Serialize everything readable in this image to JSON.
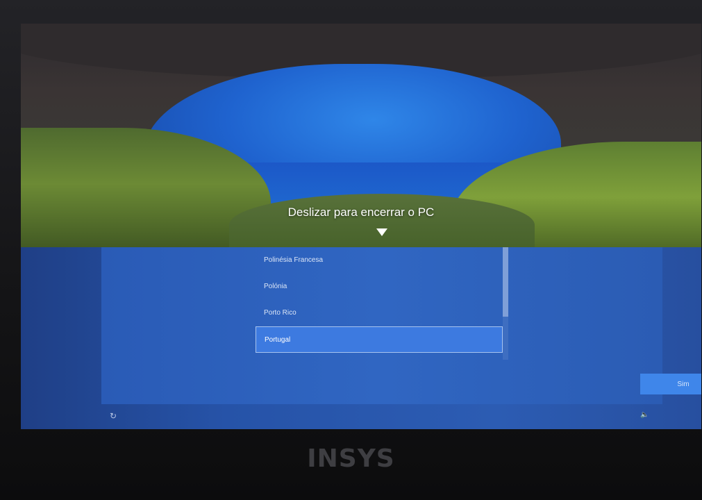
{
  "shutdown": {
    "prompt": "Deslizar para encerrar o PC",
    "arrow_icon": "arrow-down-icon"
  },
  "region_list": {
    "items": [
      "Polinésia Francesa",
      "Polónia",
      "Porto Rico",
      "Portugal"
    ],
    "selected": "Portugal"
  },
  "buttons": {
    "next_label": "Sim"
  },
  "footer": {
    "ease_of_access_icon": "ease-of-access-icon",
    "volume_icon": "volume-icon"
  },
  "device": {
    "brand": "INSYS"
  },
  "colors": {
    "panel": "#2c5cb3",
    "selection": "#3d7ae0",
    "button": "#3f86ea"
  }
}
